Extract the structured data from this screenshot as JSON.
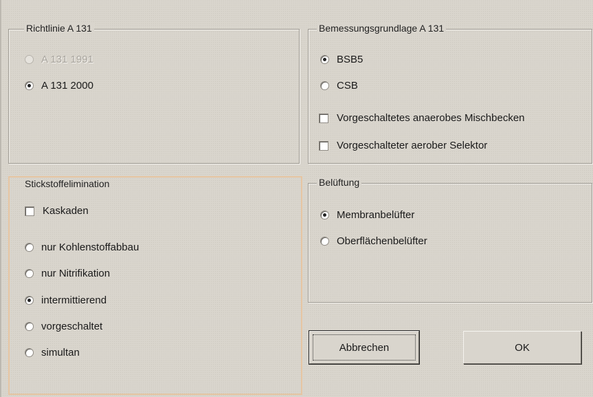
{
  "richtlinie": {
    "title": "Richtlinie A 131",
    "options": [
      {
        "label": "A 131 1991",
        "checked": false,
        "disabled": true
      },
      {
        "label": "A 131 2000",
        "checked": true,
        "disabled": false
      }
    ]
  },
  "bemessung": {
    "title": "Bemessungsgrundlage A 131",
    "options": [
      {
        "label": "BSB5",
        "checked": true
      },
      {
        "label": "CSB",
        "checked": false
      }
    ],
    "checkboxes": [
      {
        "label": "Vorgeschaltetes anaerobes Mischbecken",
        "checked": false
      },
      {
        "label": "Vorgeschalteter aerober Selektor",
        "checked": false
      }
    ]
  },
  "stickstoff": {
    "title": "Stickstoffelimination",
    "checkbox": {
      "label": "Kaskaden",
      "checked": false
    },
    "options": [
      {
        "label": "nur Kohlenstoffabbau",
        "checked": false
      },
      {
        "label": "nur Nitrifikation",
        "checked": false
      },
      {
        "label": "intermittierend",
        "checked": true
      },
      {
        "label": "vorgeschaltet",
        "checked": false
      },
      {
        "label": "simultan",
        "checked": false
      }
    ]
  },
  "belueftung": {
    "title": "Belüftung",
    "options": [
      {
        "label": "Membranbelüfter",
        "checked": true
      },
      {
        "label": "Oberflächenbelüfter",
        "checked": false
      }
    ]
  },
  "buttons": {
    "cancel": "Abbrechen",
    "ok": "OK"
  }
}
